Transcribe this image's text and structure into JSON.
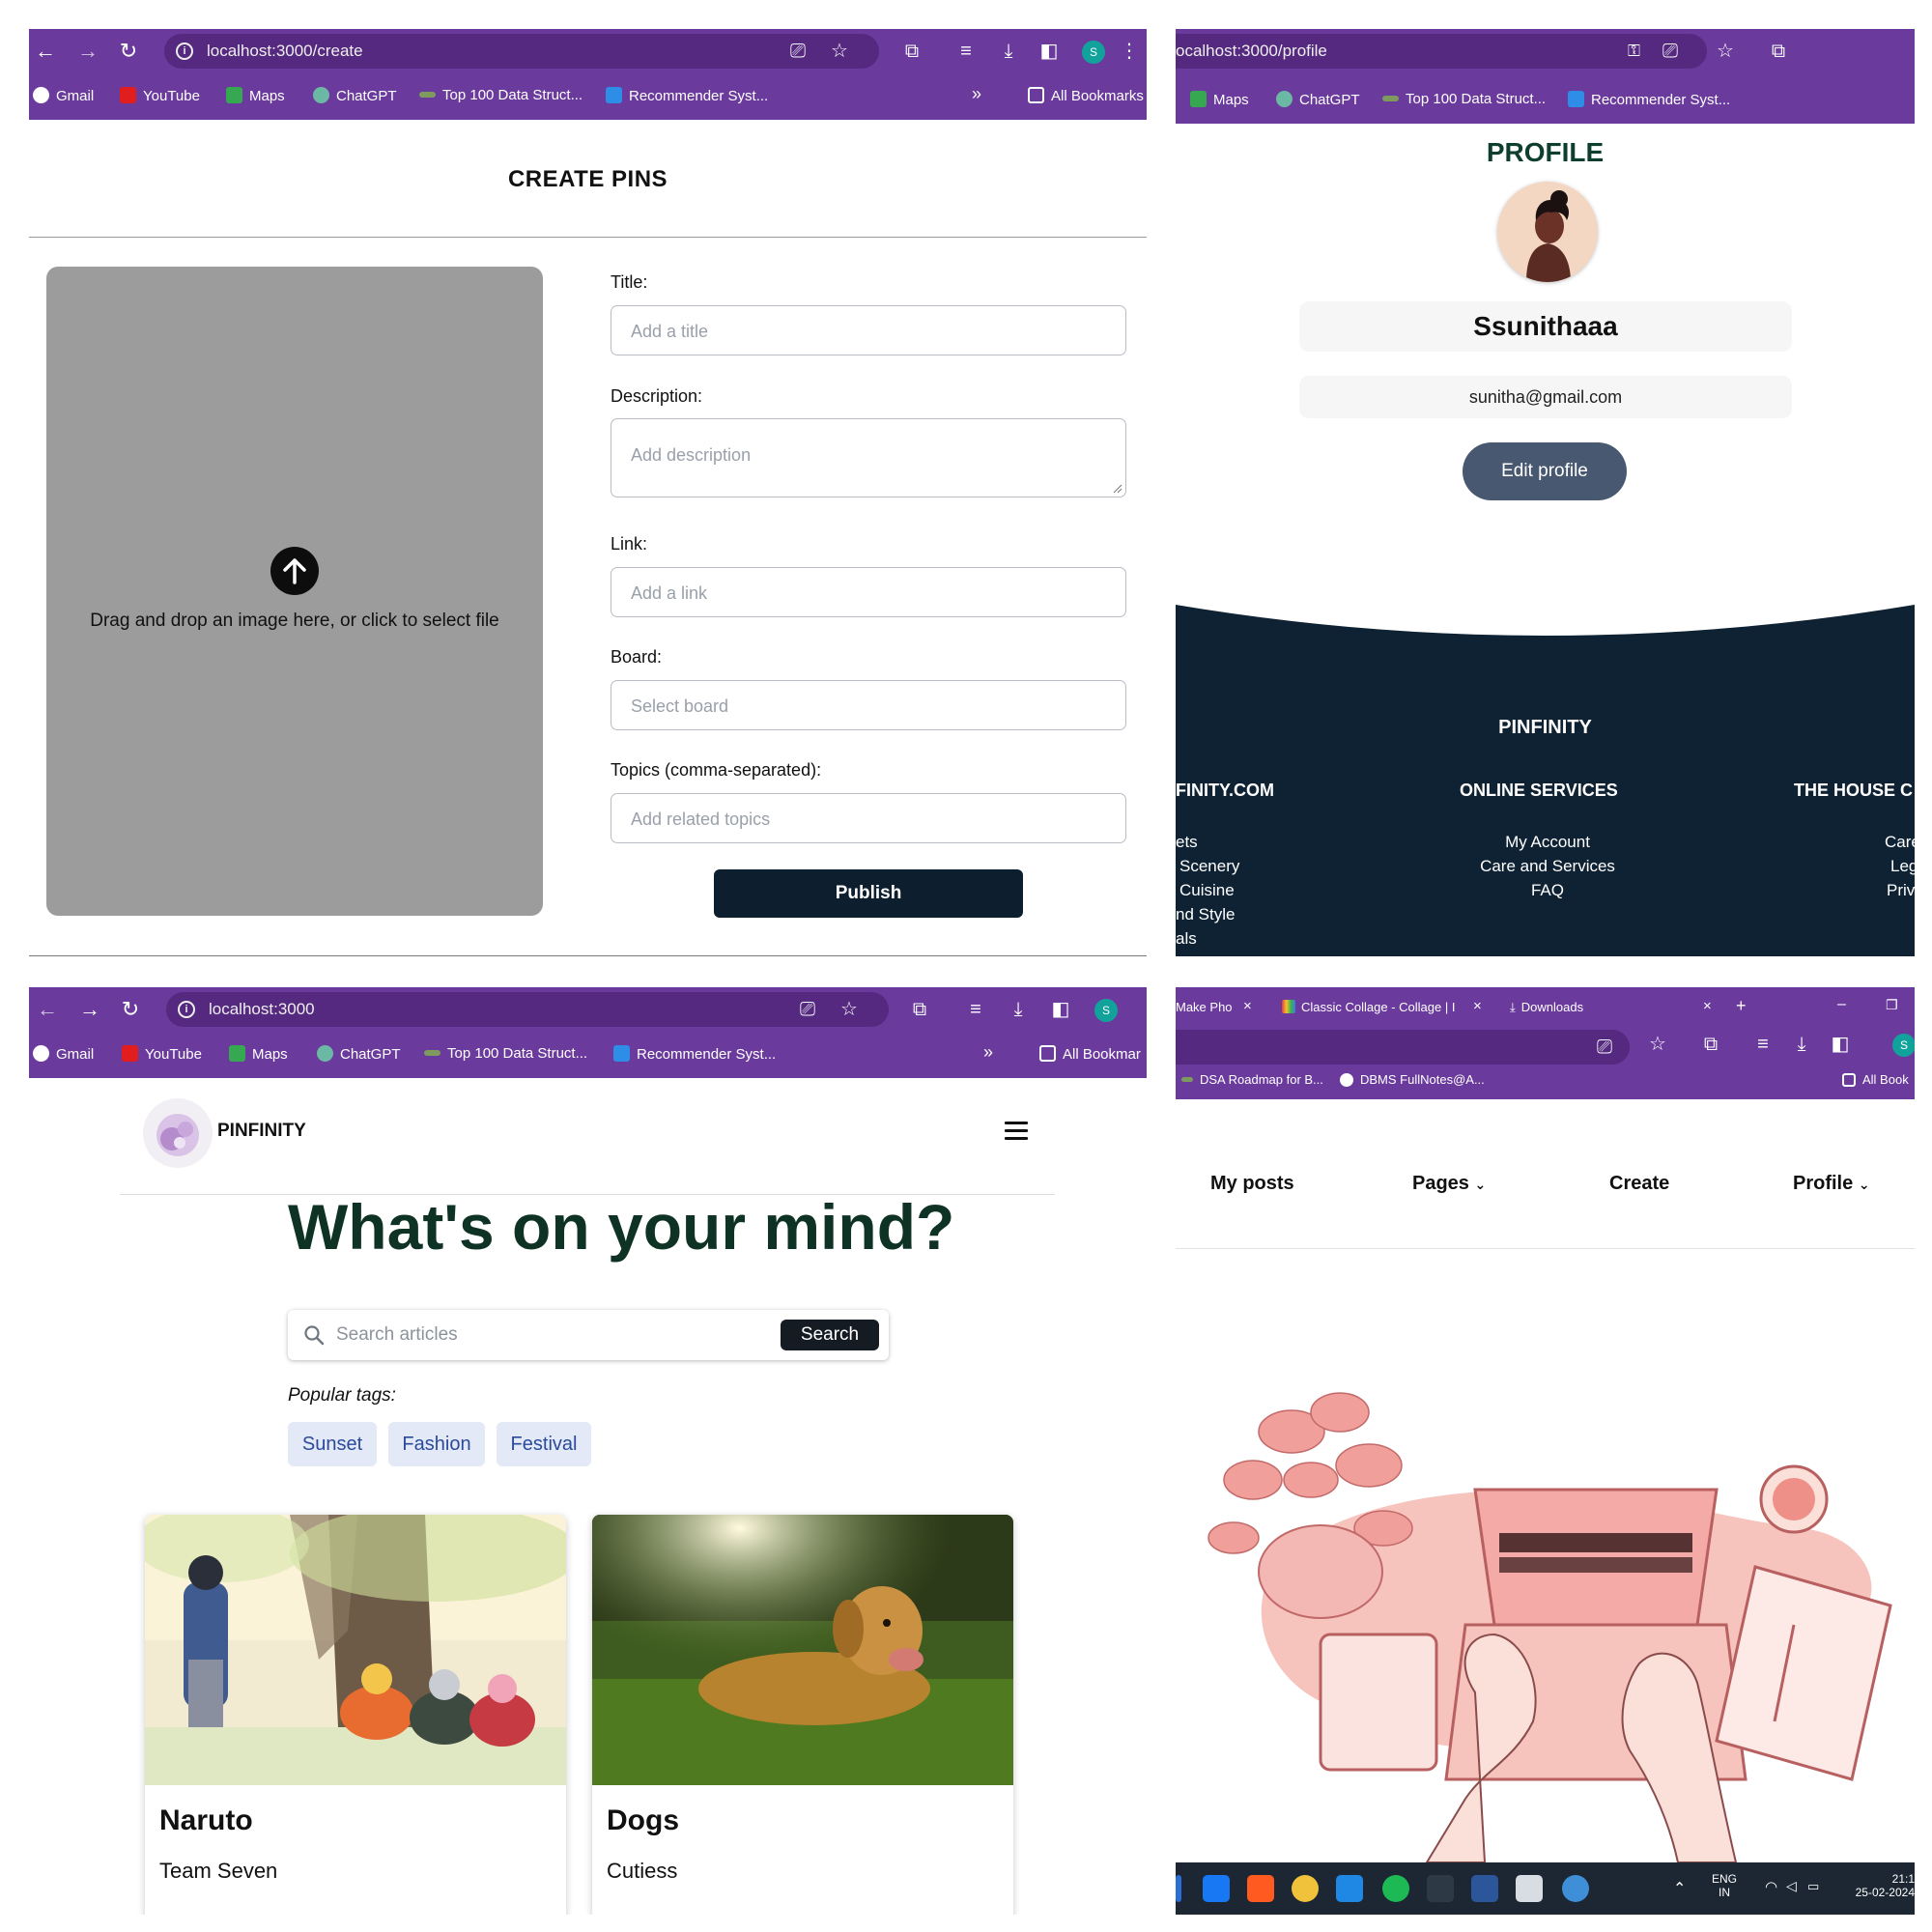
{
  "browser": {
    "bookmarks": [
      "Gmail",
      "YouTube",
      "Maps",
      "ChatGPT",
      "Top 100 Data Struct...",
      "Recommender Syst..."
    ],
    "more_glyph": "»",
    "all_bookmarks": "All Bookmarks",
    "all_bookmarks_short": "All Bookmar",
    "all_bookmarks_tiny": "All Book",
    "profile_initial": "S"
  },
  "create_page": {
    "url": "localhost:3000/create",
    "heading": "CREATE PINS",
    "drop_text": "Drag and drop an image here, or click to select file",
    "fields": [
      {
        "label": "Title:",
        "placeholder": "Add a title"
      },
      {
        "label": "Description:",
        "placeholder": "Add description"
      },
      {
        "label": "Link:",
        "placeholder": "Add a link"
      },
      {
        "label": "Board:",
        "placeholder": "Select board"
      },
      {
        "label": "Topics (comma-separated):",
        "placeholder": "Add related topics"
      }
    ],
    "publish": "Publish"
  },
  "profile_page": {
    "url": "ocalhost:3000/profile",
    "bookmarks": [
      "Maps",
      "ChatGPT",
      "Top 100 Data Struct...",
      "Recommender Syst..."
    ],
    "heading": "PROFILE",
    "username": "Ssunithaaa",
    "email": "sunitha@gmail.com",
    "edit_button": "Edit profile",
    "footer": {
      "brand": "PINFINITY",
      "columns": [
        {
          "heading": "FINITY.COM",
          "links": [
            "ets",
            "Scenery",
            "Cuisine",
            "nd Style",
            "als"
          ]
        },
        {
          "heading": "ONLINE SERVICES",
          "links": [
            "My Account",
            "Care and Services",
            "FAQ"
          ]
        },
        {
          "heading": "THE HOUSE C",
          "links": [
            "Care",
            "Leg",
            "Priv"
          ]
        }
      ]
    }
  },
  "home_page": {
    "url": "localhost:3000",
    "brand": "PINFINITY",
    "hero": "What's on your mind?",
    "search_placeholder": "Search articles",
    "search_button": "Search",
    "popular_label": "Popular tags:",
    "tags": [
      "Sunset",
      "Fashion",
      "Festival"
    ],
    "cards": [
      {
        "title": "Naruto",
        "subtitle": "Team Seven"
      },
      {
        "title": "Dogs",
        "subtitle": "Cutiess"
      }
    ]
  },
  "nav_page": {
    "tabs": [
      "Make Pho",
      "Classic Collage - Collage | I",
      "Downloads"
    ],
    "tab_close": "×",
    "new_tab": "+",
    "bookmarks": [
      "DSA Roadmap for B...",
      "DBMS FullNotes@A..."
    ],
    "nav_items": [
      "My posts",
      "Pages",
      "Create",
      "Profile"
    ],
    "taskbar": {
      "lang_top": "ENG",
      "lang_bottom": "IN",
      "time": "21:1",
      "date": "25-02-2024"
    }
  },
  "colors": {
    "chrome_purple": "#6a3a9c",
    "navy": "#0d1e2e",
    "footer_navy": "#0f2233",
    "heading_green": "#0e3f2e",
    "tag_bg": "#e3e9f7",
    "tag_text": "#2b4a9a",
    "illustration_pink": "#f4b8b4"
  }
}
